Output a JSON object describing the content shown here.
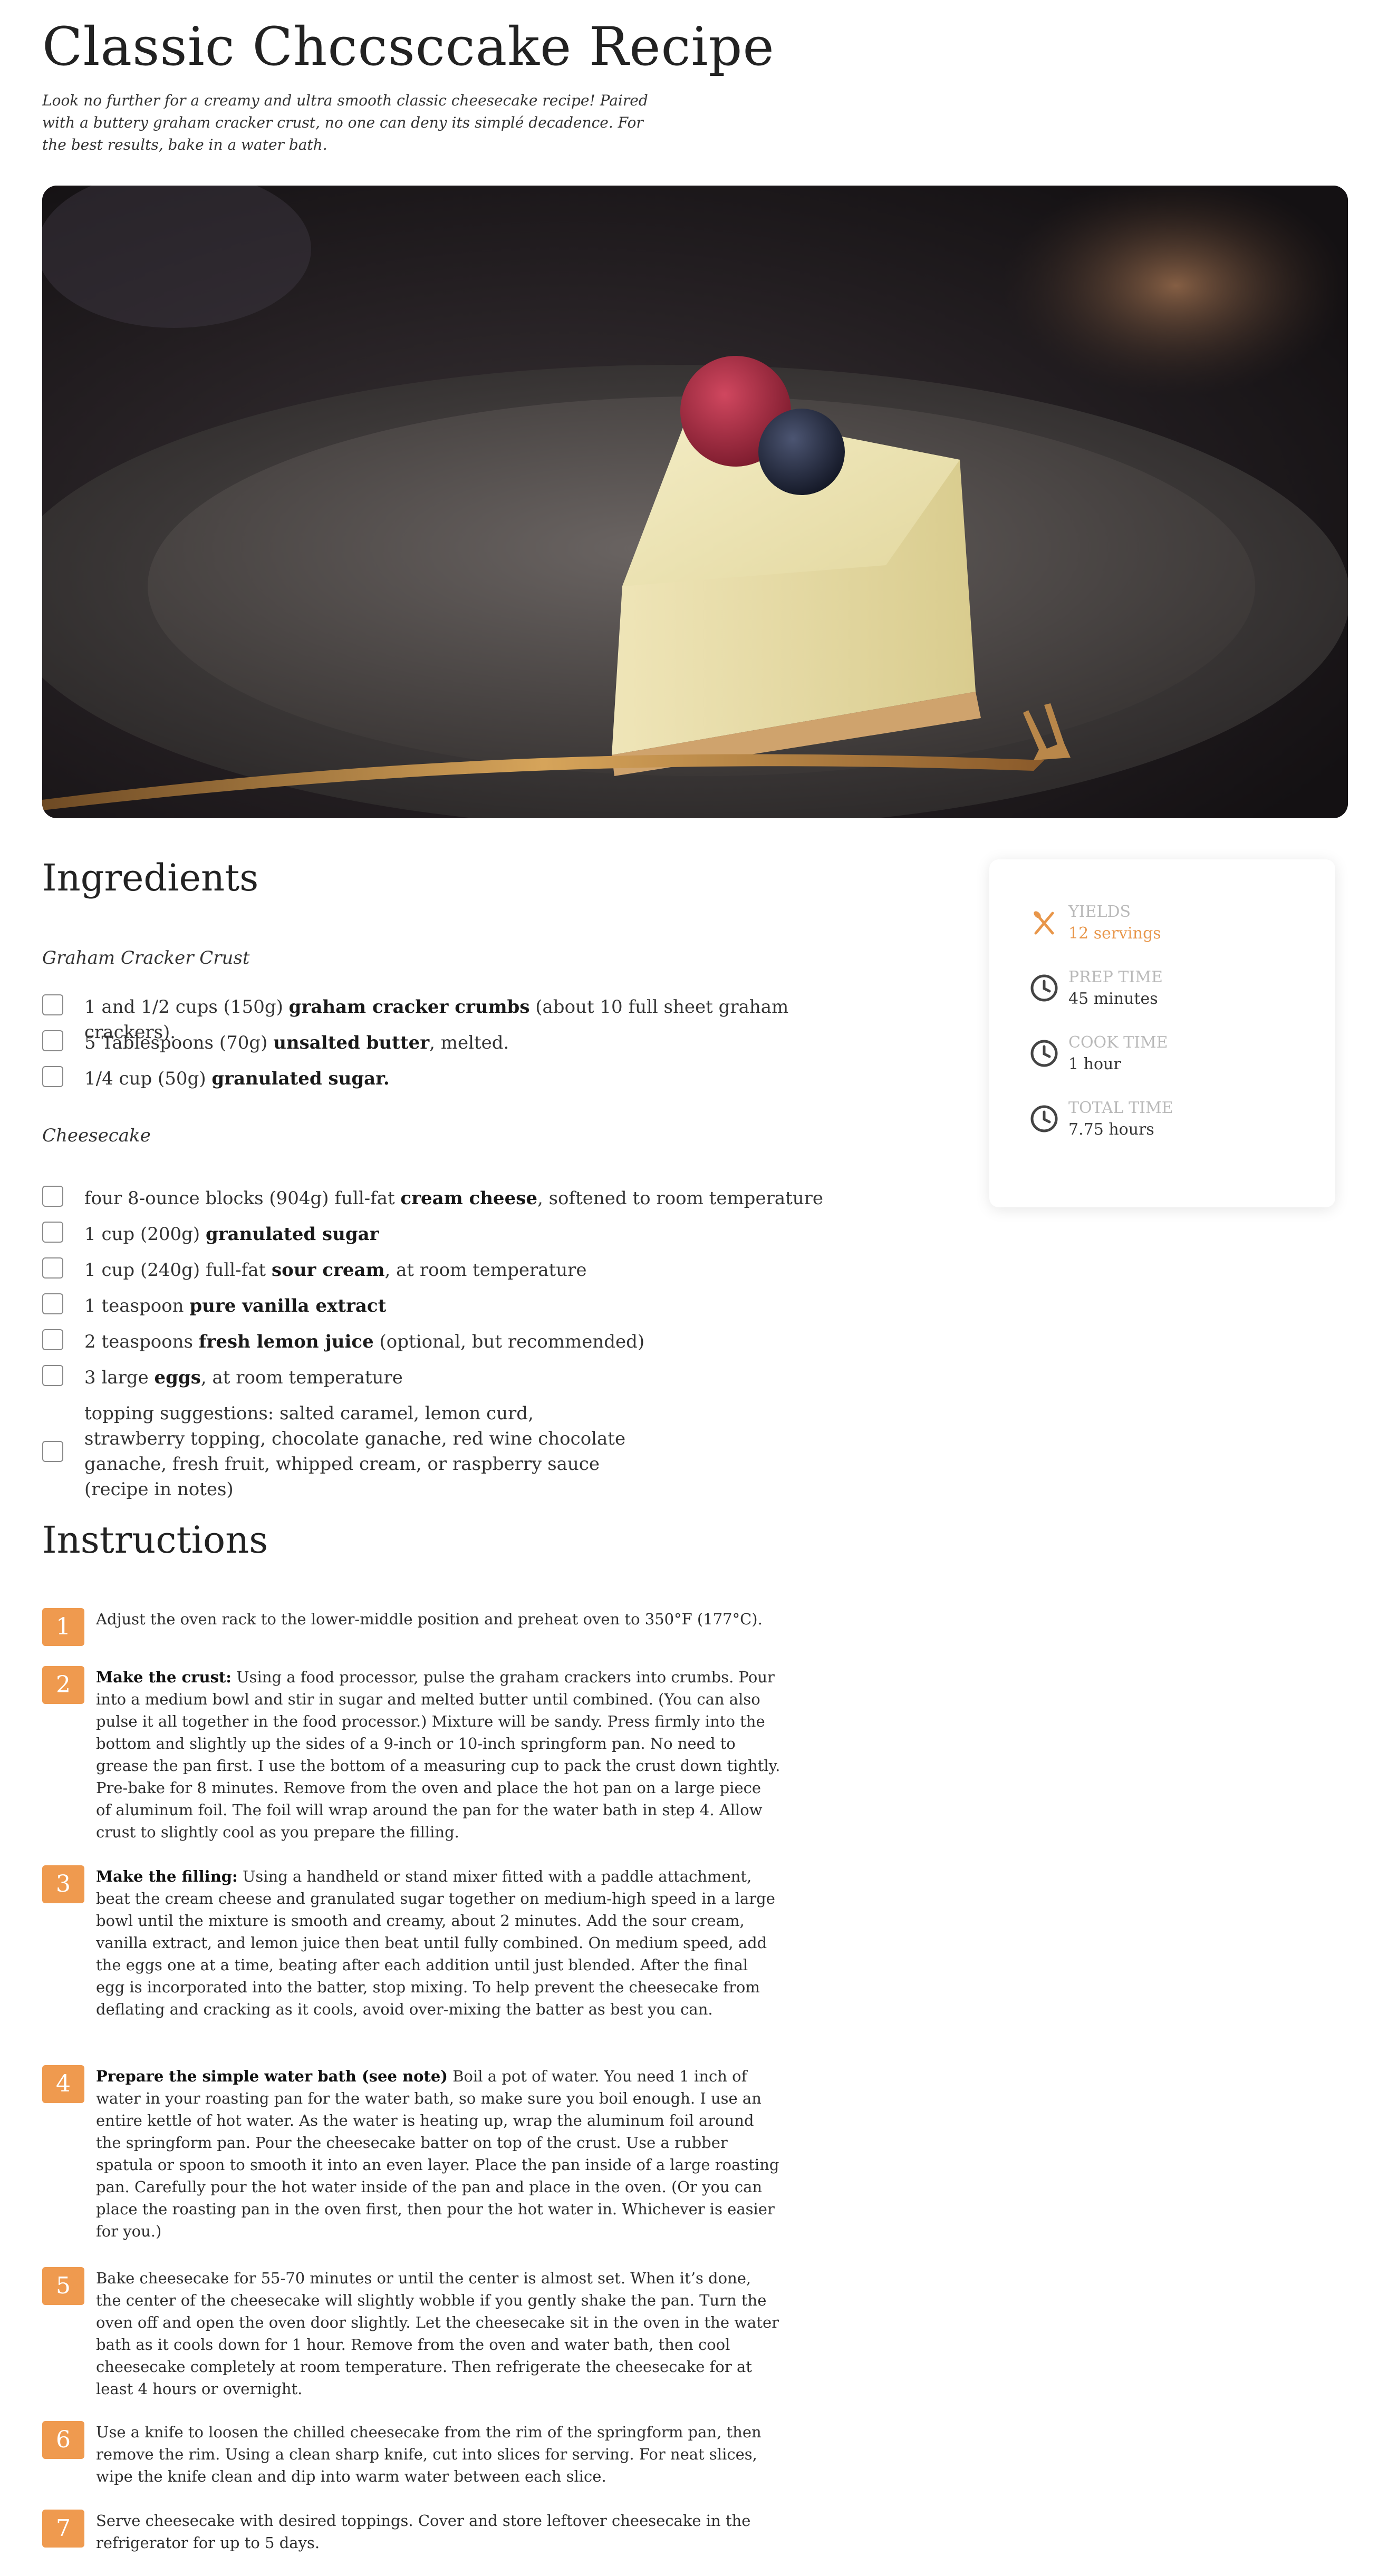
{
  "recipe": {
    "title": "Classic Chccsccake Recipe",
    "intro": "Look no further for a creamy and ultra smooth classic cheesecake recipe! Paired with a buttery graham cracker crust, no one can deny its simplé decadence. For the best results, bake in a water bath.",
    "hero_alt": "slice of cheesecake topped with a raspberry and a blueberry on a dark plate with a fork"
  },
  "ingredients": {
    "heading": "Ingredients",
    "groups": [
      {
        "name": "Graham Cracker Crust",
        "items": [
          {
            "pre": "1 and 1/2 cups (150g) ",
            "bold": "graham cracker crumbs",
            "post": " (about 10 full sheet graham crackers)."
          },
          {
            "pre": "5 Tablespoons (70g) ",
            "bold": "unsalted butter",
            "post": ", melted."
          },
          {
            "pre": "1/4 cup (50g) ",
            "bold": "granulated sugar.",
            "post": ""
          }
        ]
      },
      {
        "name": "Cheesecake",
        "items": [
          {
            "pre": "four 8-ounce blocks (904g) full-fat ",
            "bold": "cream cheese",
            "post": ", softened to room temperature"
          },
          {
            "pre": "1 cup (200g) ",
            "bold": "granulated sugar",
            "post": ""
          },
          {
            "pre": "1 cup (240g) full-fat ",
            "bold": "sour cream",
            "post": ", at room temperature"
          },
          {
            "pre": "1 teaspoon ",
            "bold": "pure vanilla extract",
            "post": ""
          },
          {
            "pre": "2 teaspoons ",
            "bold": "fresh lemon juice",
            "post": " (optional, but recommended)"
          },
          {
            "pre": "3 large ",
            "bold": "eggs",
            "post": ", at room temperature"
          },
          {
            "pre": "topping suggestions: salted caramel, lemon curd, strawberry topping, chocolate ganache, red wine chocolate ganache, fresh fruit, whipped cream, or raspberry sauce (recipe in notes)",
            "bold": "",
            "post": ""
          }
        ]
      }
    ]
  },
  "meta": {
    "yields_label": "YIELDS",
    "yields_value": "12 servings",
    "prep_label": "PREP TIME",
    "prep_value": "45 minutes",
    "cook_label": "COOK TIME",
    "cook_value": "1 hour",
    "total_label": "TOTAL TIME",
    "total_value": "7.75 hours",
    "accent_color": "#e8964a",
    "icons": [
      "fork-spoon-icon",
      "clock-icon",
      "clock-icon",
      "clock-icon"
    ]
  },
  "instructions": {
    "heading": "Instructions",
    "step_color": "#ef9a4f",
    "steps": [
      {
        "n": "1",
        "bold": "",
        "text": "Adjust the oven rack to the lower-middle position and preheat oven to 350°F (177°C)."
      },
      {
        "n": "2",
        "bold": "Make the crust:",
        "text": " Using a food processor, pulse the graham crackers into crumbs. Pour into a medium bowl and stir in sugar and melted butter until combined. (You can also pulse it all together in the food processor.) Mixture will be sandy. Press firmly into the bottom and slightly up the sides of a 9-inch or 10-inch springform pan. No need to grease the pan first. I use the bottom of a measuring cup to pack the crust down tightly. Pre-bake for 8 minutes. Remove from the oven and place the hot pan on a large piece of aluminum foil. The foil will wrap around the pan for the water bath in step 4. Allow crust to slightly cool as you prepare the filling."
      },
      {
        "n": "3",
        "bold": "Make the filling:",
        "text": " Using a handheld or stand mixer fitted with a paddle attachment, beat the cream cheese and granulated sugar together on medium-high speed in a large bowl until the mixture is smooth and creamy, about 2 minutes. Add the sour cream, vanilla extract, and lemon juice then beat until fully combined. On medium speed, add the eggs one at a time, beating after each addition until just blended. After the final egg is incorporated into the batter, stop mixing. To help prevent the cheesecake from deflating and cracking as it cools, avoid over-mixing the batter as best you can."
      },
      {
        "n": "4",
        "bold": "Prepare the simple water bath (see note)",
        "text": " Boil a pot of water. You need 1 inch of water in your roasting pan for the water bath, so make sure you boil enough. I use an entire kettle of hot water. As the water is heating up, wrap the aluminum foil around the springform pan. Pour the cheesecake batter on top of the crust. Use a rubber spatula or spoon to smooth it into an even layer. Place the pan inside of a large roasting pan. Carefully pour the hot water inside of the pan and place in the oven. (Or you can place the roasting pan in the oven first, then pour the hot water in. Whichever is easier for you.)"
      },
      {
        "n": "5",
        "bold": "",
        "text": "Bake cheesecake for 55-70 minutes or until the center is almost set. When it’s done, the center of the cheesecake will slightly wobble if you gently shake the pan. Turn the oven off and open the oven door slightly. Let the cheesecake sit in the oven in the water bath as it cools down for 1 hour. Remove from the oven and water bath, then cool cheesecake completely at room temperature. Then refrigerate the cheesecake for at least 4 hours or overnight."
      },
      {
        "n": "6",
        "bold": "",
        "text": "Use a knife to loosen the chilled cheesecake from the rim of the springform pan, then remove the rim. Using a clean sharp knife, cut into slices for serving. For neat slices, wipe the knife clean and dip into warm water between each slice."
      },
      {
        "n": "7",
        "bold": "",
        "text": "Serve cheesecake with desired toppings. Cover and store leftover cheesecake in the refrigerator for up to 5 days."
      }
    ]
  }
}
